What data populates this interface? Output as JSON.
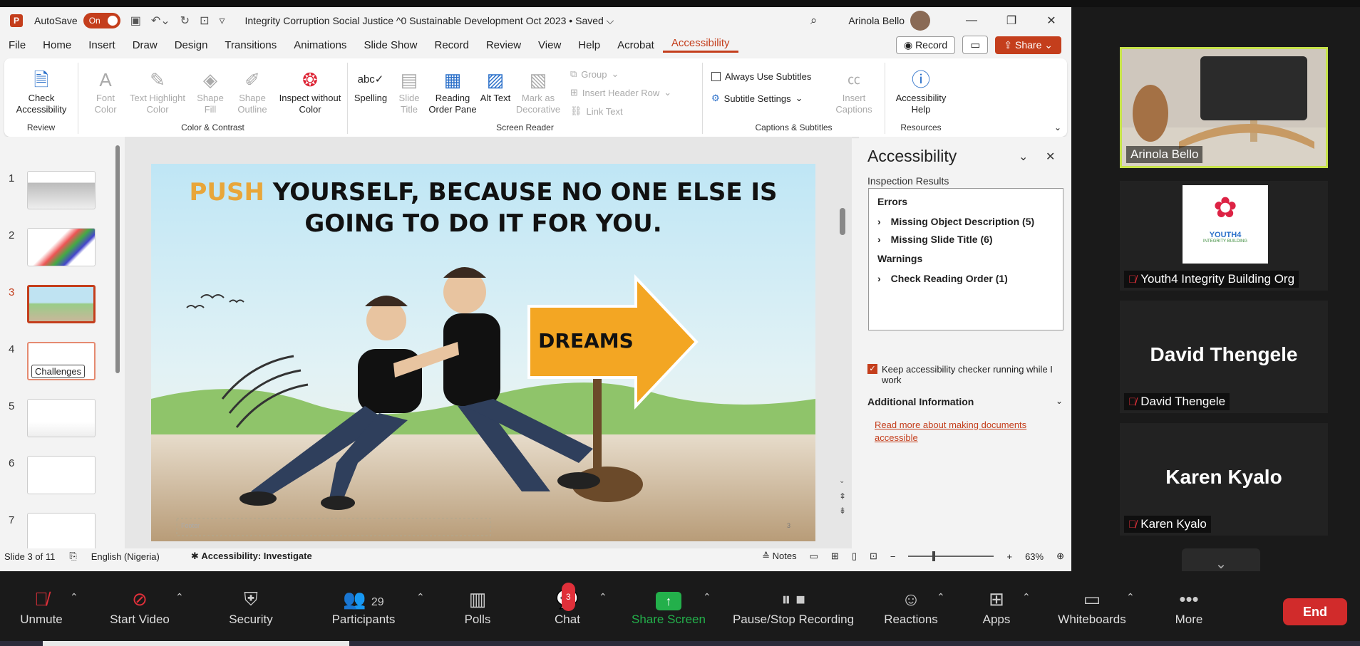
{
  "titlebar": {
    "app_icon": "P",
    "autosave_label": "AutoSave",
    "autosave_state": "On",
    "document_title": "Integrity Corruption Social Justice ^0 Sustainable Development Oct 2023 • Saved ⌵",
    "user_name": "Arinola Bello"
  },
  "tabs": [
    "File",
    "Home",
    "Insert",
    "Draw",
    "Design",
    "Transitions",
    "Animations",
    "Slide Show",
    "Record",
    "Review",
    "View",
    "Help",
    "Acrobat",
    "Accessibility"
  ],
  "tab_buttons": {
    "record": "Record",
    "share": "Share"
  },
  "ribbon": {
    "review": {
      "check": "Check Accessibility",
      "label": "Review"
    },
    "color": {
      "font_color": "Font Color",
      "text_highlight": "Text Highlight Color",
      "shape_fill": "Shape Fill",
      "shape_outline": "Shape Outline",
      "inspect": "Inspect without Color",
      "label": "Color & Contrast"
    },
    "screen_reader": {
      "spelling": "Spelling",
      "slide_title": "Slide Title",
      "reading_order": "Reading Order Pane",
      "alt_text": "Alt Text",
      "mark_decorative": "Mark as Decorative",
      "group": "Group",
      "insert_header_row": "Insert Header Row",
      "link_text": "Link Text",
      "label": "Screen Reader"
    },
    "captions": {
      "always_use": "Always Use Subtitles",
      "subtitle_settings": "Subtitle Settings",
      "insert_captions": "Insert Captions",
      "label": "Captions & Subtitles"
    },
    "resources": {
      "help": "Accessibility Help",
      "label": "Resources"
    }
  },
  "thumbnails": [
    {
      "num": "1"
    },
    {
      "num": "2"
    },
    {
      "num": "3",
      "selected": true
    },
    {
      "num": "4"
    },
    {
      "num": "5"
    },
    {
      "num": "6"
    },
    {
      "num": "7"
    }
  ],
  "thumb_tooltip": "Challenges",
  "slide": {
    "headline_accent": "PUSH",
    "headline_rest": " YOURSELF, BECAUSE NO ONE ELSE IS GOING TO DO IT FOR YOU.",
    "sign_text": "DREAMS",
    "footer_text": "Footer",
    "page_number": "3",
    "accent_color": "#e8a63a"
  },
  "accessibility_pane": {
    "title": "Accessibility",
    "inspection_label": "Inspection Results",
    "errors_heading": "Errors",
    "errors": [
      "Missing Object Description (5)",
      "Missing Slide Title (6)"
    ],
    "warnings_heading": "Warnings",
    "warnings": [
      "Check Reading Order (1)"
    ],
    "keep_running": "Keep accessibility checker running while I work",
    "additional_info": "Additional Information",
    "read_more": "Read more about making documents accessible"
  },
  "statusbar": {
    "slide_count": "Slide 3 of 11",
    "language": "English (Nigeria)",
    "accessibility": "Accessibility: Investigate",
    "notes": "Notes",
    "zoom": "63%"
  },
  "gallery": {
    "tiles": [
      {
        "name": "Arinola Bello"
      },
      {
        "name": "Youth4 Integrity Building Org",
        "logo_text": "YOUTH4",
        "logo_sub": "INTEGRITY BUILDING"
      },
      {
        "name": "David Thengele"
      },
      {
        "name": "Karen Kyalo"
      }
    ]
  },
  "zoom_toolbar": {
    "unmute": "Unmute",
    "start_video": "Start Video",
    "security": "Security",
    "participants": "Participants",
    "participants_count": "29",
    "polls": "Polls",
    "chat": "Chat",
    "chat_badge": "3",
    "share_screen": "Share Screen",
    "recording": "Pause/Stop Recording",
    "reactions": "Reactions",
    "apps": "Apps",
    "whiteboards": "Whiteboards",
    "more": "More",
    "end": "End"
  },
  "colors": {
    "brand": "#c43e1c",
    "zoom_green": "#23b04b",
    "end_red": "#d12b2b"
  }
}
